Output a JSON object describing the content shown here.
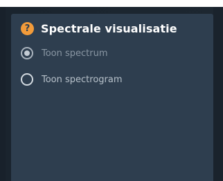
{
  "panel": {
    "title": "Spectrale visualisatie",
    "help_icon": "?",
    "options": [
      {
        "label": "Toon spectrum",
        "selected": true
      },
      {
        "label": "Toon spectrogram",
        "selected": false
      }
    ]
  },
  "colors": {
    "panel_bg": "#2e3e4f",
    "page_bg": "#1b2530",
    "accent_help": "#f29b3a",
    "title_text": "#ffffff"
  }
}
